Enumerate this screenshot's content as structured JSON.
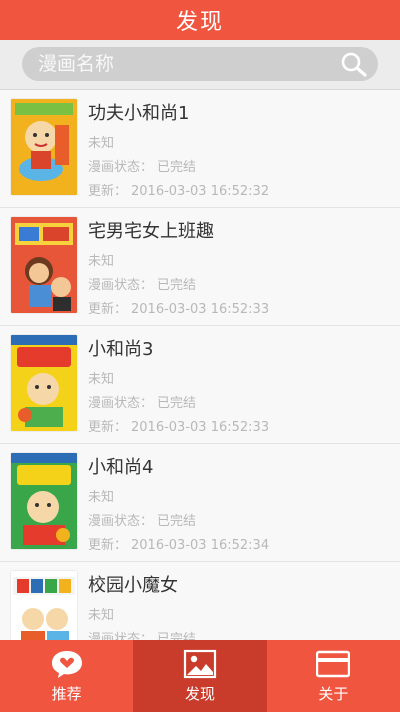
{
  "header": {
    "title": "发现"
  },
  "search": {
    "placeholder": "漫画名称"
  },
  "list": {
    "items": [
      {
        "title": "功夫小和尚1",
        "author": "未知",
        "status_label": "漫画状态：",
        "status": "已完结",
        "update_label": "更新：",
        "update": "2016-03-03 16:52:32"
      },
      {
        "title": "宅男宅女上班趣",
        "author": "未知",
        "status_label": "漫画状态：",
        "status": "已完结",
        "update_label": "更新：",
        "update": "2016-03-03 16:52:33"
      },
      {
        "title": "小和尚3",
        "author": "未知",
        "status_label": "漫画状态：",
        "status": "已完结",
        "update_label": "更新：",
        "update": "2016-03-03 16:52:33"
      },
      {
        "title": "小和尚4",
        "author": "未知",
        "status_label": "漫画状态：",
        "status": "已完结",
        "update_label": "更新：",
        "update": "2016-03-03 16:52:34"
      },
      {
        "title": "校园小魔女",
        "author": "未知",
        "status_label": "漫画状态：",
        "status": "已完结",
        "update_label": "更新：",
        "update": ""
      }
    ]
  },
  "nav": {
    "tabs": [
      {
        "label": "推荐",
        "icon": "heart-chat-icon"
      },
      {
        "label": "发现",
        "icon": "picture-icon",
        "active": true
      },
      {
        "label": "关于",
        "icon": "card-icon"
      }
    ]
  },
  "colors": {
    "accent": "#f05540",
    "accent_active": "#c93c2c"
  }
}
